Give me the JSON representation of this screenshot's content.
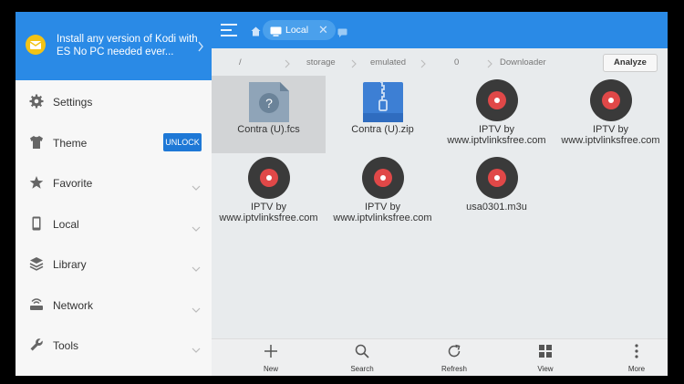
{
  "promo": {
    "text": "Install any version of Kodi with ES No PC needed ever..."
  },
  "sidebar": {
    "items": [
      {
        "label": "Settings"
      },
      {
        "label": "Theme",
        "badge": "UNLOCK"
      },
      {
        "label": "Favorite"
      },
      {
        "label": "Local"
      },
      {
        "label": "Library"
      },
      {
        "label": "Network"
      },
      {
        "label": "Tools"
      }
    ]
  },
  "topbar": {
    "tab_label": "Local"
  },
  "breadcrumb": {
    "items": [
      "/",
      "storage",
      "emulated",
      "0",
      "Downloader"
    ],
    "analyze_label": "Analyze"
  },
  "files": [
    {
      "name": "Contra (U).fcs",
      "type": "unknown"
    },
    {
      "name": "Contra (U).zip",
      "type": "zip"
    },
    {
      "name": "IPTV by www.iptvlinksfree.com",
      "type": "media"
    },
    {
      "name": "IPTV by www.iptvlinksfree.com",
      "type": "media"
    },
    {
      "name": "IPTV by www.iptvlinksfree.com",
      "type": "media"
    },
    {
      "name": "IPTV by www.iptvlinksfree.com",
      "type": "media"
    },
    {
      "name": "usa0301.m3u",
      "type": "media"
    }
  ],
  "toolbar": {
    "items": [
      {
        "label": "New"
      },
      {
        "label": "Search"
      },
      {
        "label": "Refresh"
      },
      {
        "label": "View"
      },
      {
        "label": "More"
      }
    ]
  },
  "colors": {
    "accent": "#2a8ae6",
    "badge": "#1e78d6",
    "media_disc": "#3a3a3a",
    "media_center": "#e04848"
  }
}
